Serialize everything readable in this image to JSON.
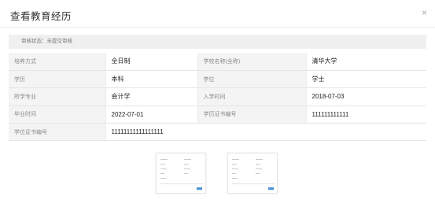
{
  "dialog": {
    "title": "查看教育经历",
    "close_glyph": "×",
    "status_text": "审核状态：未提交审核"
  },
  "info_rows": [
    [
      {
        "label": "培养方式",
        "value": "全日制"
      },
      {
        "label": "学校名称(全称)",
        "value": "清华大学"
      }
    ],
    [
      {
        "label": "学历",
        "value": "本科"
      },
      {
        "label": "学位",
        "value": "学士"
      }
    ],
    [
      {
        "label": "所学专业",
        "value": "会计学"
      },
      {
        "label": "入学时间",
        "value": "2018-07-03"
      }
    ],
    [
      {
        "label": "毕业时间",
        "value": "2022-07-01"
      },
      {
        "label": "学历证书编号",
        "value": "111111111111"
      }
    ],
    [
      {
        "label": "学位证书编号",
        "value": "11111111111111111"
      }
    ]
  ],
  "attachments": [
    {
      "name": "attachment-thumbnail-1"
    },
    {
      "name": "attachment-thumbnail-2"
    }
  ]
}
